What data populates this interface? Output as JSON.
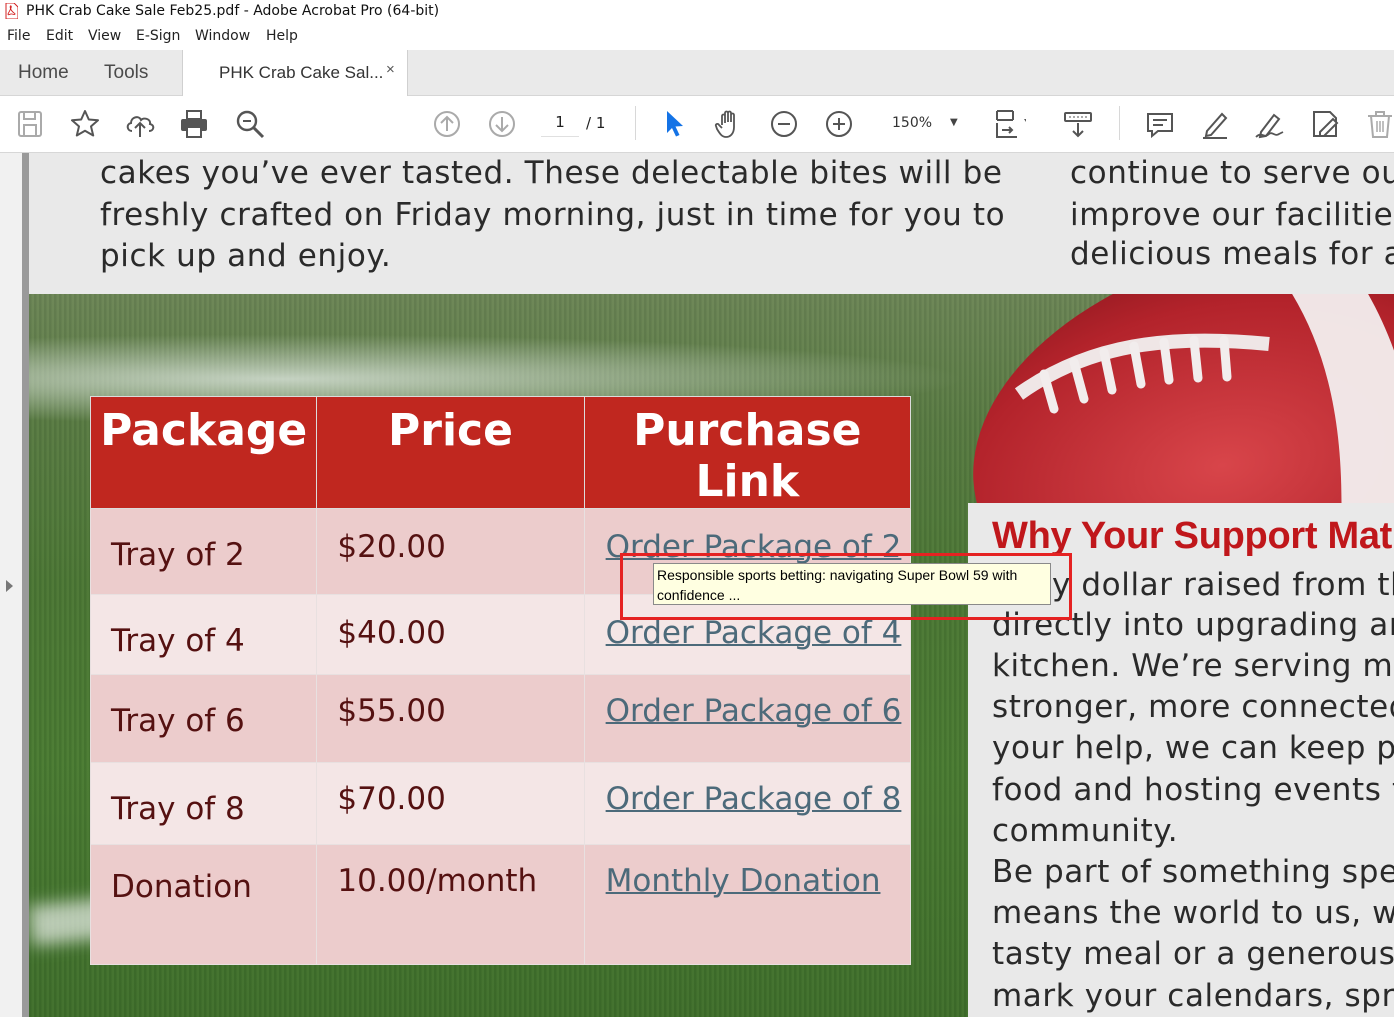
{
  "window": {
    "title": "PHK Crab Cake Sale Feb25.pdf - Adobe Acrobat Pro (64-bit)"
  },
  "menu": [
    "File",
    "Edit",
    "View",
    "E-Sign",
    "Window",
    "Help"
  ],
  "tabs": {
    "home": "Home",
    "tools": "Tools",
    "document": "PHK Crab Cake Sal...",
    "close": "×"
  },
  "toolbar": {
    "page_current": "1",
    "page_total": "/ 1",
    "zoom": "150%"
  },
  "document": {
    "intro_lines": [
      "cakes you’ve ever tasted. These delectable bites will be",
      "freshly crafted on Friday morning, just in time for you to",
      "pick up and enjoy."
    ],
    "right_lines": [
      "continue to serve our",
      "improve our facilities",
      "delicious meals for al"
    ],
    "table": {
      "headers": [
        "Package",
        "Price",
        "Purchase Link"
      ],
      "rows": [
        {
          "package": "Tray of 2",
          "price": "$20.00",
          "link": "Order Package of 2"
        },
        {
          "package": "Tray of 4",
          "price": "$40.00",
          "link": "Order Package of 4"
        },
        {
          "package": "Tray of 6",
          "price": "$55.00",
          "link": "Order Package of 6"
        },
        {
          "package": "Tray of 8",
          "price": "$70.00",
          "link": "Order Package of 8"
        },
        {
          "package": "Donation",
          "price": "10.00/month",
          "link": "Monthly Donation"
        }
      ]
    },
    "why": {
      "heading": "Why Your Support Mat",
      "lines": [
        "y dollar raised from th",
        "directly into upgrading an",
        "kitchen. We’re serving me",
        "stronger, more connected",
        "your help, we can keep pr",
        "food and hosting events th",
        "community.",
        "Be part of something spec",
        "means the world to us, wh",
        "tasty meal or a generous d",
        "mark your calendars, spre"
      ]
    }
  },
  "tooltip": {
    "line1": "Responsible sports betting: navigating Super Bowl 59 with",
    "line2": "confidence ..."
  },
  "colors": {
    "table_header": "#c0271f",
    "heading_red": "#c0171b",
    "link": "#4c6a7a",
    "highlight_box": "#e52222",
    "acrobat_blue": "#1473e6"
  }
}
